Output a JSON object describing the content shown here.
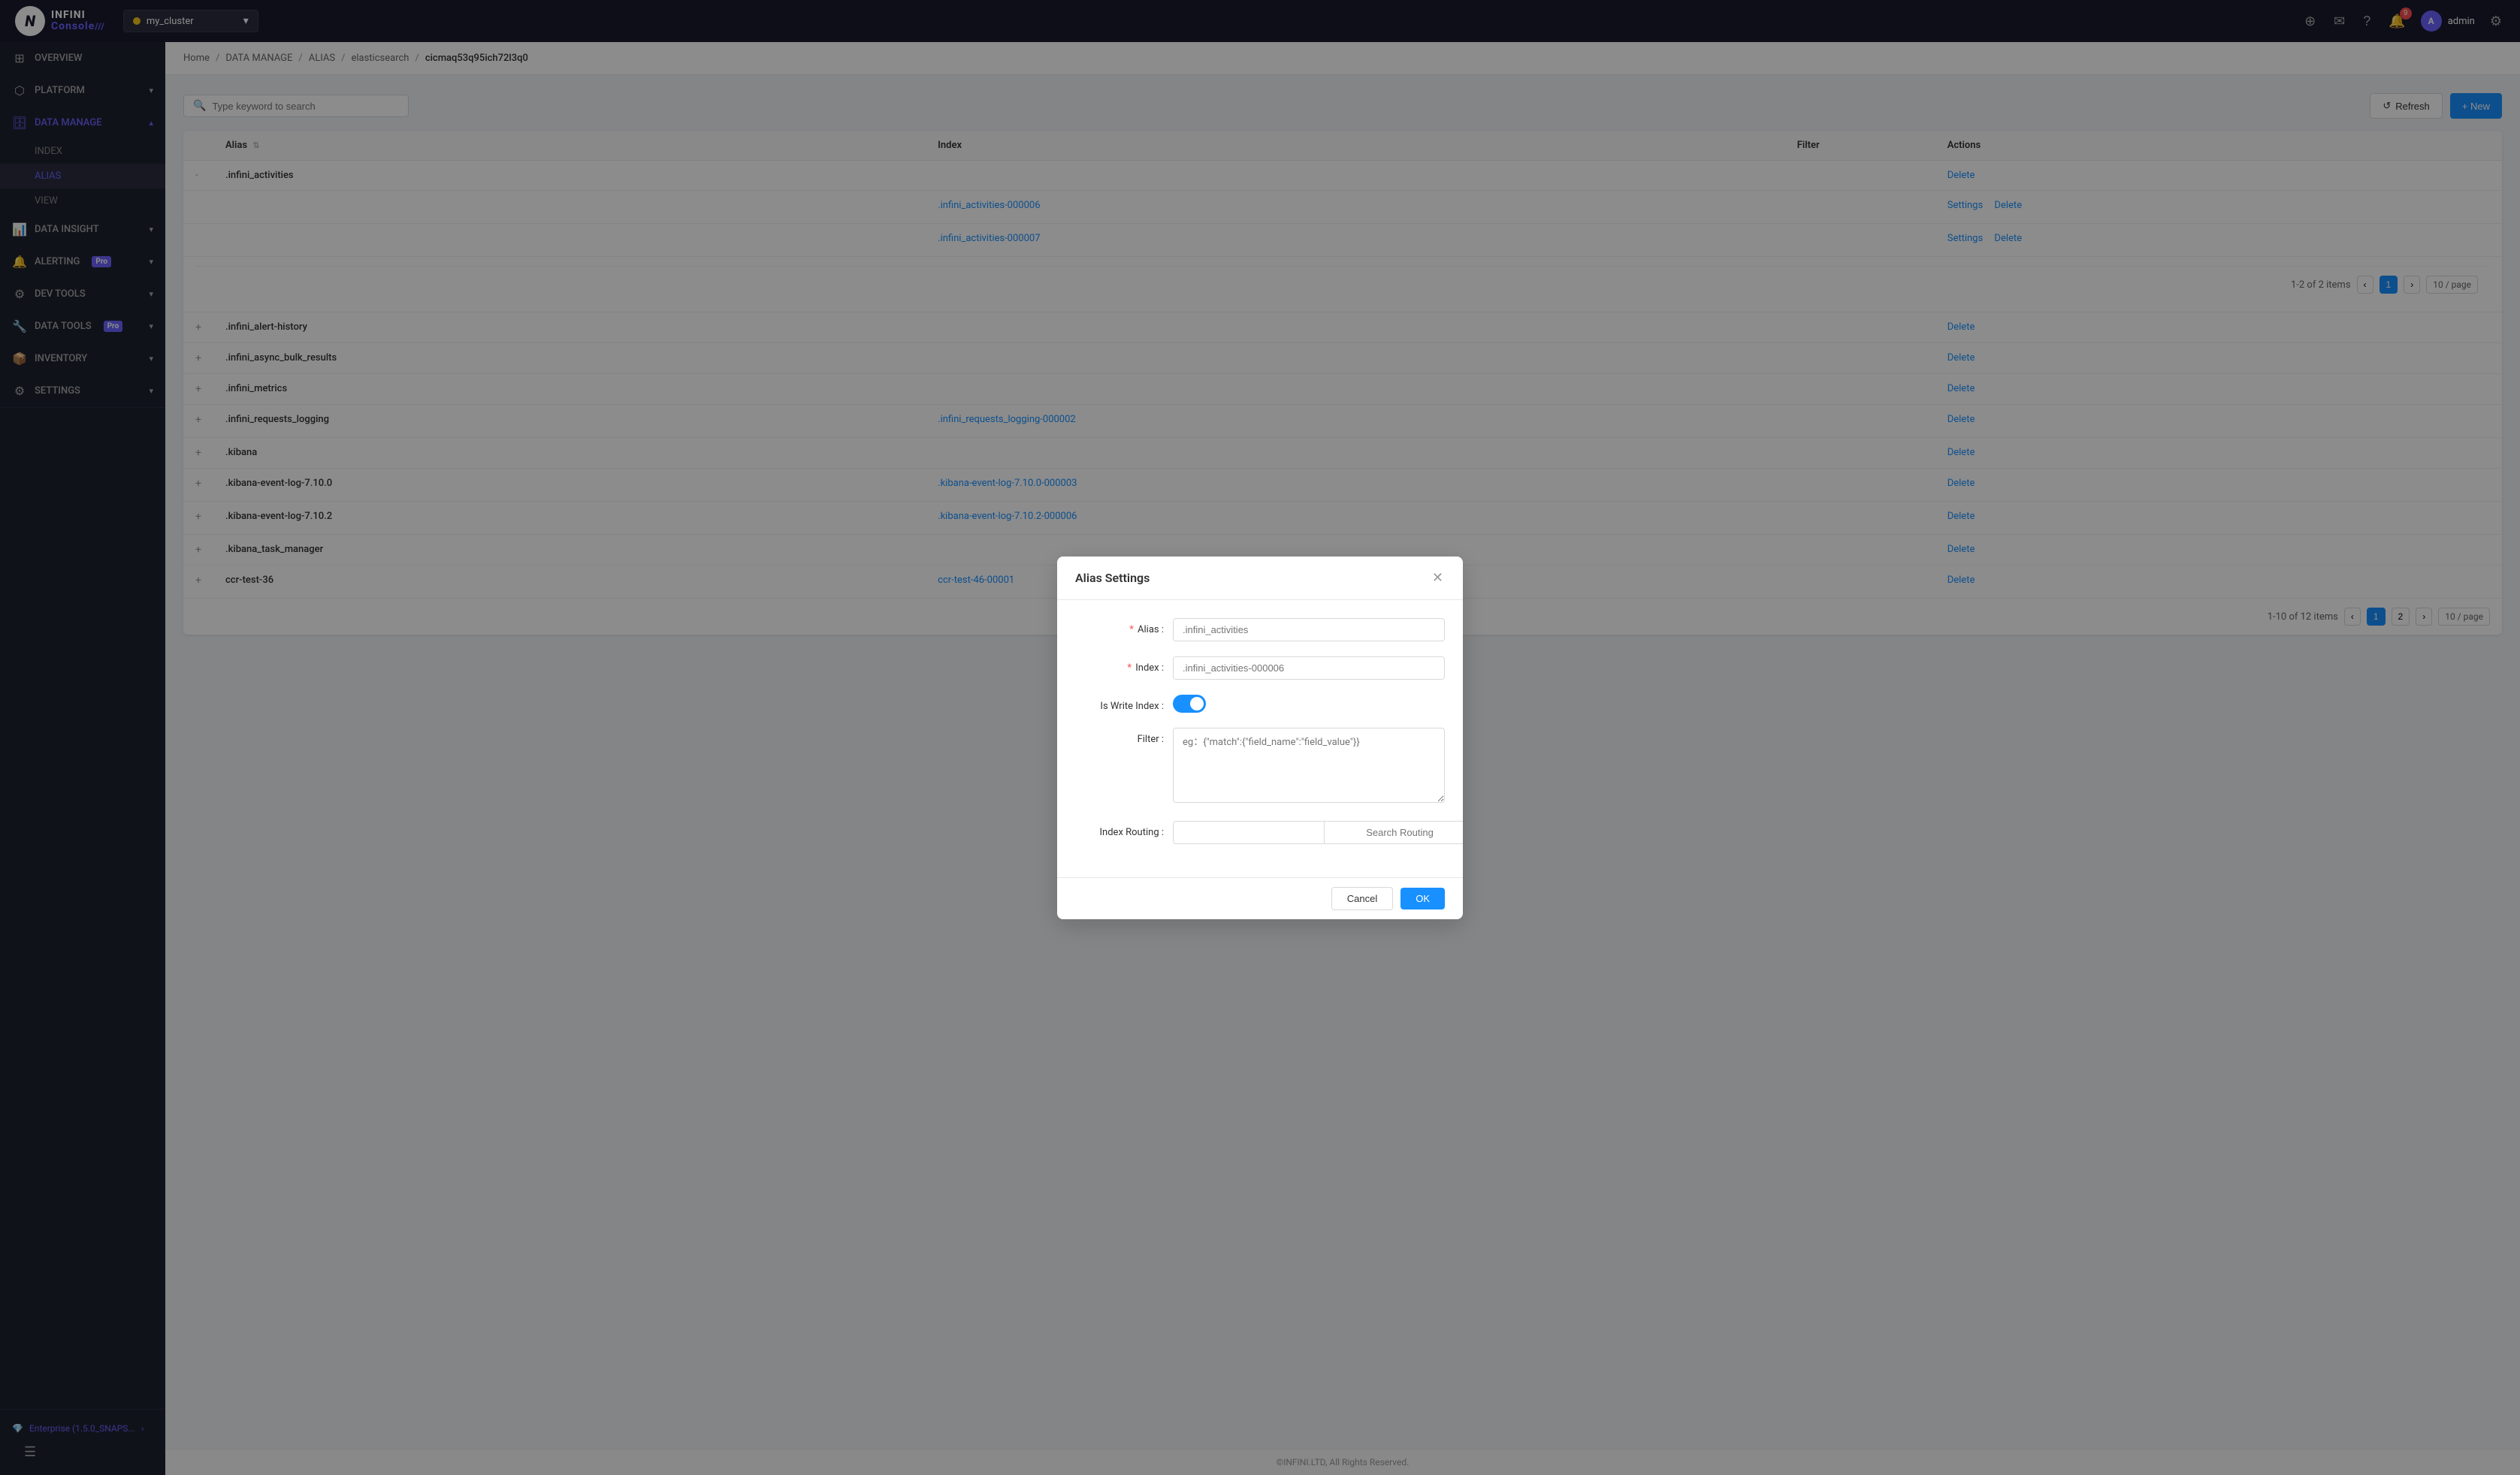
{
  "app": {
    "logo_n": "N",
    "logo_infini": "INFINI",
    "logo_console": "Console",
    "logo_bars": "///",
    "footer_text": "©INFINI.LTD, All Rights Reserved."
  },
  "cluster": {
    "name": "my_cluster",
    "dot_color": "#f5c518"
  },
  "topbar": {
    "notification_count": "9",
    "admin_label": "admin",
    "admin_initial": "A"
  },
  "sidebar": {
    "items": [
      {
        "id": "overview",
        "label": "OVERVIEW",
        "icon": "⊞",
        "has_children": false,
        "active": false
      },
      {
        "id": "platform",
        "label": "PLATFORM",
        "icon": "⬡",
        "has_children": true,
        "active": false
      },
      {
        "id": "data-manage",
        "label": "DATA MANAGE",
        "icon": "🗄",
        "has_children": true,
        "active": true
      },
      {
        "id": "data-insight",
        "label": "DATA INSIGHT",
        "icon": "📊",
        "has_children": true,
        "active": false
      },
      {
        "id": "alerting",
        "label": "ALERTING",
        "icon": "🔔",
        "has_children": true,
        "active": false,
        "pro": true
      },
      {
        "id": "dev-tools",
        "label": "DEV TOOLS",
        "icon": "⚙",
        "has_children": true,
        "active": false
      },
      {
        "id": "data-tools",
        "label": "DATA TOOLS",
        "icon": "🔧",
        "has_children": true,
        "active": false,
        "pro": true
      },
      {
        "id": "inventory",
        "label": "INVENTORY",
        "icon": "📦",
        "has_children": true,
        "active": false
      },
      {
        "id": "settings",
        "label": "SETTINGS",
        "icon": "⚙",
        "has_children": true,
        "active": false
      }
    ],
    "sub_items": [
      {
        "id": "index",
        "label": "INDEX",
        "parent": "data-manage",
        "active": false
      },
      {
        "id": "alias",
        "label": "ALIAS",
        "parent": "data-manage",
        "active": true
      },
      {
        "id": "view",
        "label": "VIEW",
        "parent": "data-manage",
        "active": false
      }
    ],
    "enterprise_label": "Enterprise (1.5.0_SNAPS...",
    "enterprise_icon": "💎"
  },
  "breadcrumb": {
    "items": [
      "Home",
      "DATA MANAGE",
      "ALIAS",
      "elasticsearch",
      "cicmaq53q95ich72l3q0"
    ]
  },
  "toolbar": {
    "search_placeholder": "Type keyword to search",
    "refresh_label": "Refresh",
    "new_label": "+ New"
  },
  "table": {
    "headers": [
      "Alias",
      "Index",
      "Filter",
      "Actions"
    ],
    "rows": [
      {
        "expand": "-",
        "alias": ".infini_activities",
        "indexes": [
          ".infini_activities-000006",
          ".infini_activities-000007"
        ],
        "index_links": [
          true,
          true
        ],
        "filter": "",
        "actions_inner": [
          "Settings",
          "Settings"
        ],
        "delete_inner": [
          "Delete",
          "Delete"
        ],
        "delete": "Delete"
      },
      {
        "expand": "+",
        "alias": ".infini_alert-history",
        "indexes": [],
        "filter": "",
        "delete": "Delete"
      },
      {
        "expand": "+",
        "alias": ".infini_async_bulk_results",
        "indexes": [],
        "filter": "",
        "delete": "Delete"
      },
      {
        "expand": "+",
        "alias": ".infini_metrics",
        "indexes": [],
        "filter": "",
        "delete": "Delete"
      },
      {
        "expand": "+",
        "alias": ".infini_requests_logging",
        "indexes": [
          ".infini_requests_logging-000002"
        ],
        "index_links": [
          true
        ],
        "filter": "",
        "delete": "Delete"
      },
      {
        "expand": "+",
        "alias": ".kibana",
        "indexes": [],
        "filter": "",
        "delete": "Delete"
      },
      {
        "expand": "+",
        "alias": ".kibana-event-log-7.10.0",
        "indexes": [
          ".kibana-event-log-7.10.0-000003"
        ],
        "index_links": [
          true
        ],
        "filter": "",
        "delete": "Delete"
      },
      {
        "expand": "+",
        "alias": ".kibana-event-log-7.10.2",
        "indexes": [
          ".kibana-event-log-7.10.2-000006"
        ],
        "index_links": [
          true
        ],
        "filter": "",
        "delete": "Delete"
      },
      {
        "expand": "+",
        "alias": ".kibana_task_manager",
        "indexes": [],
        "filter": "",
        "delete": "Delete"
      },
      {
        "expand": "+",
        "alias": "ccr-test-36",
        "indexes": [
          "ccr-test-46-00001"
        ],
        "index_links": [
          true
        ],
        "filter": "",
        "delete": "Delete"
      }
    ],
    "inner_pagination": {
      "text": "1-2 of 2 items",
      "current_page": "1",
      "per_page": "10 / page"
    },
    "pagination": {
      "text": "1-10 of 12 items",
      "current_page": "1",
      "page_2": "2",
      "per_page": "10 / page"
    }
  },
  "modal": {
    "title": "Alias Settings",
    "alias_label": "* Alias :",
    "alias_placeholder": ".infini_activities",
    "index_label": "* Index :",
    "index_placeholder": ".infini_activities-000006",
    "is_write_index_label": "Is Write Index :",
    "filter_label": "Filter :",
    "filter_placeholder": "eg：{\"match\":{\"field_name\":\"field_value\"}}",
    "index_routing_label": "Index Routing :",
    "search_routing_placeholder": "Search Routing",
    "index_routing_placeholder": "",
    "cancel_label": "Cancel",
    "ok_label": "OK",
    "toggle_on": true
  }
}
